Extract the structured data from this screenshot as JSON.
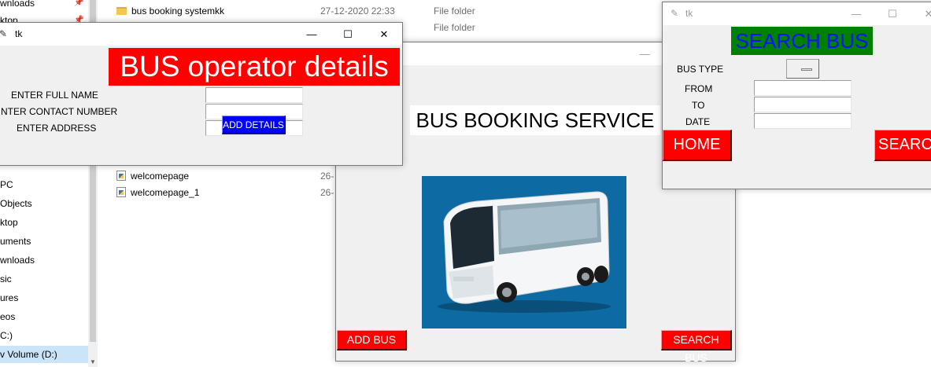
{
  "explorer": {
    "nav_items": [
      {
        "label": "wnloads",
        "pinned": true
      },
      {
        "label": "ktop",
        "pinned": true
      },
      {
        "label": "PC",
        "pinned": false
      },
      {
        "label": "Objects",
        "pinned": false
      },
      {
        "label": "ktop",
        "pinned": false
      },
      {
        "label": "uments",
        "pinned": false
      },
      {
        "label": "wnloads",
        "pinned": false
      },
      {
        "label": "sic",
        "pinned": false
      },
      {
        "label": "ures",
        "pinned": false
      },
      {
        "label": "eos",
        "pinned": false
      },
      {
        "label": "C:)",
        "pinned": false
      },
      {
        "label": "v Volume (D:)",
        "pinned": false
      }
    ],
    "files": [
      {
        "name": "bus booking systemkk",
        "date": "27-12-2020 22:33",
        "type": "File folder",
        "icon": "folder-icon"
      },
      {
        "name": "",
        "date": "",
        "type": "File folder",
        "icon": "folder-icon"
      },
      {
        "name": "welcomepage",
        "date": "26-",
        "type": "",
        "icon": "python-file-icon"
      },
      {
        "name": "welcomepage_1",
        "date": "26-",
        "type": "",
        "icon": "python-file-icon"
      }
    ]
  },
  "main_window": {
    "heading": "BUS BOOKING SERVICE",
    "add_bus_label": "ADD BUS",
    "search_bus_label": "SEARCH BUS",
    "image_icon": "bus-image"
  },
  "operator_window": {
    "title": "tk",
    "header": "BUS operator details",
    "name_label": "ENTER FULL NAME",
    "contact_label": "NTER CONTACT NUMBER",
    "address_label": "ENTER ADDRESS",
    "name_value": "",
    "contact_value": "",
    "address_value": "",
    "add_details_label": "ADD DETAILS"
  },
  "search_window": {
    "title": "tk",
    "header": "SEARCH BUS",
    "bus_type_label": "BUS TYPE",
    "from_label": "FROM",
    "to_label": "TO",
    "date_label": "DATE",
    "from_value": "",
    "to_value": "",
    "date_value": "",
    "home_label": "HOME",
    "search_label": "SEARC"
  },
  "window_controls": {
    "minimize": "—",
    "maximize": "☐",
    "close": "✕"
  },
  "colors": {
    "red": "#ff0000",
    "blue": "#0000ff",
    "green": "#008000",
    "header_text_blue": "#1212ff",
    "window_bg": "#f0f0f0",
    "bus_image_bg": "#0e6aa3",
    "selection": "#cce4f7"
  }
}
